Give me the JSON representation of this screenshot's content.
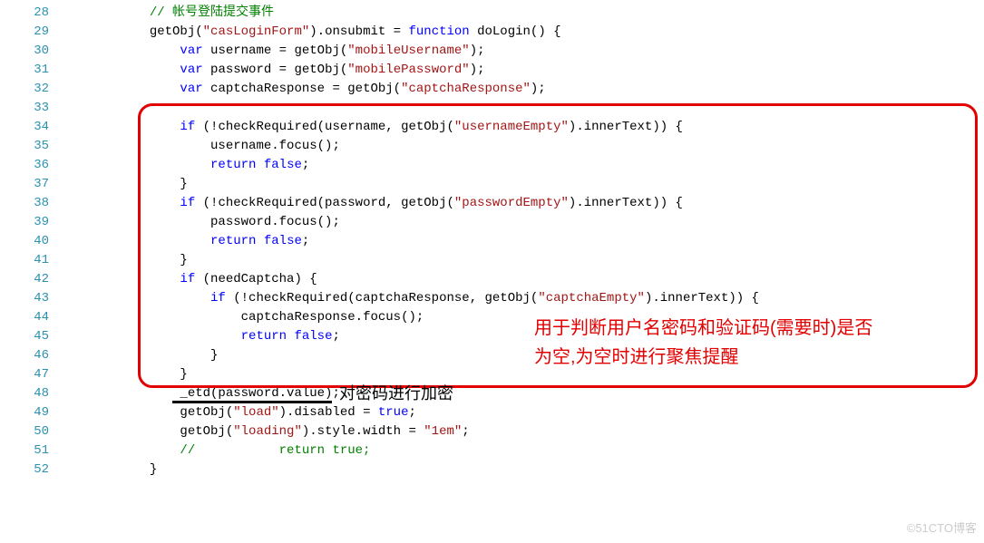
{
  "gutter": [
    "28",
    "29",
    "30",
    "31",
    "32",
    "33",
    "34",
    "35",
    "36",
    "37",
    "38",
    "39",
    "40",
    "41",
    "42",
    "43",
    "44",
    "45",
    "46",
    "47",
    "48",
    "49",
    "50",
    "51",
    "52"
  ],
  "c": {
    "l28a": "// 帐号登陆提交事件",
    "l29a": "getObj(",
    "l29b": "\"casLoginForm\"",
    "l29c": ").onsubmit = ",
    "l29d": "function",
    "l29e": " doLogin() {",
    "l30a": "var",
    "l30b": " username = getObj(",
    "l30c": "\"mobileUsername\"",
    "l30d": ");",
    "l31a": "var",
    "l31b": " password = getObj(",
    "l31c": "\"mobilePassword\"",
    "l31d": ");",
    "l32a": "var",
    "l32b": " captchaResponse = getObj(",
    "l32c": "\"captchaResponse\"",
    "l32d": ");",
    "l34a": "if",
    "l34b": " (!checkRequired(username, getObj(",
    "l34c": "\"usernameEmpty\"",
    "l34d": ").innerText)) {",
    "l35a": "username.focus();",
    "l36a": "return",
    "l36b": " ",
    "l36c": "false",
    "l36d": ";",
    "l37a": "}",
    "l38a": "if",
    "l38b": " (!checkRequired(password, getObj(",
    "l38c": "\"passwordEmpty\"",
    "l38d": ").innerText)) {",
    "l39a": "password.focus();",
    "l40a": "return",
    "l40b": " ",
    "l40c": "false",
    "l40d": ";",
    "l41a": "}",
    "l42a": "if",
    "l42b": " (needCaptcha) {",
    "l43a": "if",
    "l43b": " (!checkRequired(captchaResponse, getObj(",
    "l43c": "\"captchaEmpty\"",
    "l43d": ").innerText)) {",
    "l44a": "captchaResponse.focus();",
    "l45a": "return",
    "l45b": " ",
    "l45c": "false",
    "l45d": ";",
    "l46a": "}",
    "l47a": "}",
    "l48a": "_etd(password.value);",
    "l49a": "getObj(",
    "l49b": "\"load\"",
    "l49c": ").disabled = ",
    "l49d": "true",
    "l49e": ";",
    "l50a": "getObj(",
    "l50b": "\"loading\"",
    "l50c": ").style.width = ",
    "l50d": "\"1em\"",
    "l50e": ";",
    "l51a": "//           return true;",
    "l52a": "}"
  },
  "annotation_red_line1": "用于判断用户名密码和验证码(需要时)是否",
  "annotation_red_line2": "为空,为空时进行聚焦提醒",
  "annotation_black": "对密码进行加密",
  "watermark": "©51CTO博客"
}
